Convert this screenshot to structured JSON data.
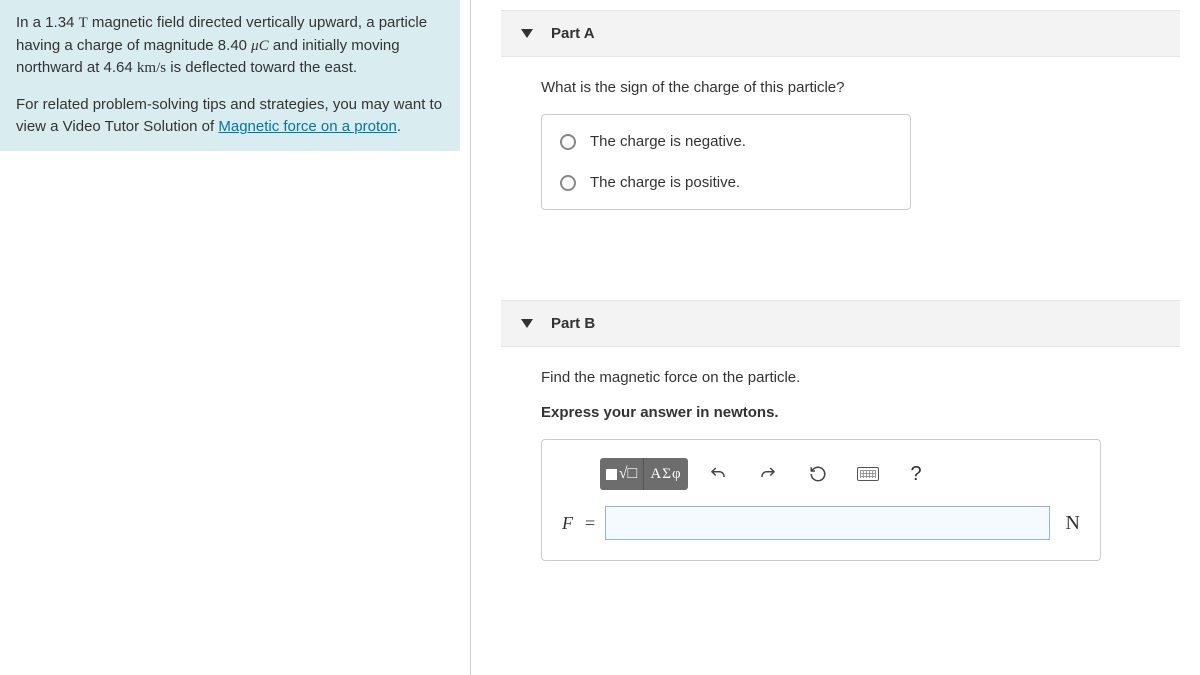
{
  "problem": {
    "line1a": "In a 1.34 ",
    "line1b": "T",
    "line1c": " magnetic field directed vertically upward, a particle having a charge of magnitude 8.40 ",
    "line1d": "μC",
    "line1e": " and initially moving northward at 4.64 ",
    "line1f": "km/s",
    "line1g": " is deflected toward the east.",
    "para2_pre": "For related problem-solving tips and strategies, you may want to view a Video Tutor Solution of ",
    "link_text": "Magnetic force on a proton",
    "para2_post": "."
  },
  "partA": {
    "title": "Part A",
    "question": "What is the sign of the charge of this particle?",
    "options": [
      "The charge is negative.",
      "The charge is positive."
    ]
  },
  "partB": {
    "title": "Part B",
    "question": "Find the magnetic force on the particle.",
    "instruction": "Express your answer in newtons.",
    "toolbar": {
      "greek_label": "ΑΣφ",
      "help": "?"
    },
    "var_label": "F",
    "equals": " = ",
    "unit": "N",
    "input_value": ""
  }
}
